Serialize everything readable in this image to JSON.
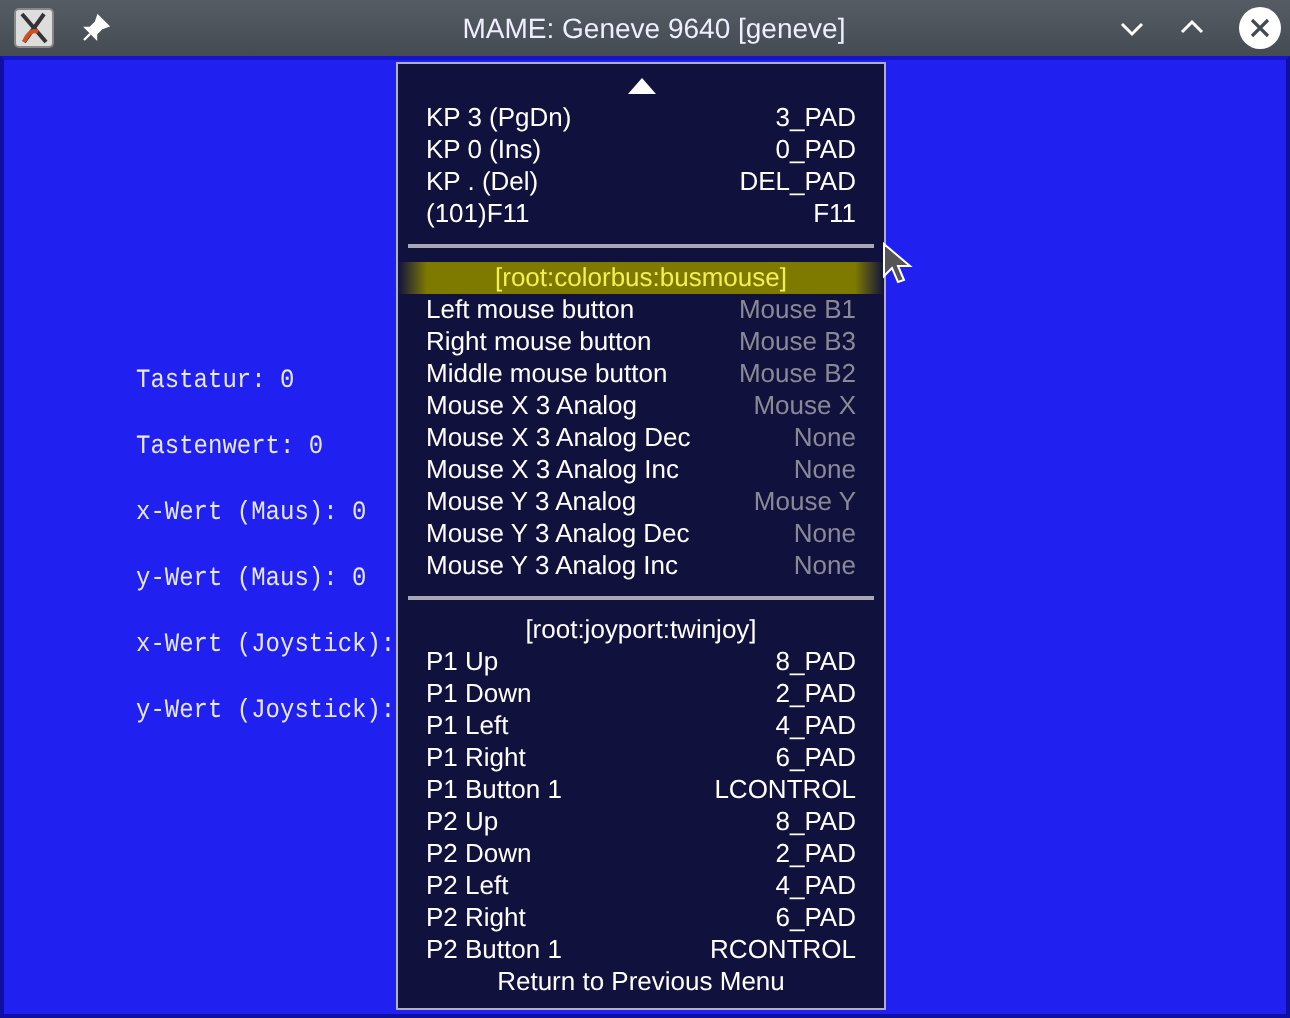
{
  "window": {
    "title": "MAME: Geneve 9640 [geneve]"
  },
  "screen_lines": [
    "Tastatur: 0",
    "Tastenwert: 0",
    "x-Wert (Maus): 0",
    "y-Wert (Maus): 0",
    "x-Wert (Joystick):",
    "y-Wert (Joystick):"
  ],
  "menu": {
    "sections": [
      {
        "items": [
          {
            "label": "KP 3 (PgDn)",
            "value": "3_PAD",
            "dimmed": false
          },
          {
            "label": "KP 0 (Ins)",
            "value": "0_PAD",
            "dimmed": false
          },
          {
            "label": "KP . (Del)",
            "value": "DEL_PAD",
            "dimmed": false
          },
          {
            "label": "(101)F11",
            "value": "F11",
            "dimmed": false
          }
        ]
      },
      {
        "header": "[root:colorbus:busmouse]",
        "selected": true,
        "items": [
          {
            "label": "Left mouse button",
            "value": "Mouse B1",
            "dimmed": true
          },
          {
            "label": "Right mouse button",
            "value": "Mouse B3",
            "dimmed": true
          },
          {
            "label": "Middle mouse button",
            "value": "Mouse B2",
            "dimmed": true
          },
          {
            "label": "Mouse X 3 Analog",
            "value": "Mouse X",
            "dimmed": true
          },
          {
            "label": "Mouse X 3 Analog Dec",
            "value": "None",
            "dimmed": true
          },
          {
            "label": "Mouse X 3 Analog Inc",
            "value": "None",
            "dimmed": true
          },
          {
            "label": "Mouse Y 3 Analog",
            "value": "Mouse Y",
            "dimmed": true
          },
          {
            "label": "Mouse Y 3 Analog Dec",
            "value": "None",
            "dimmed": true
          },
          {
            "label": "Mouse Y 3 Analog Inc",
            "value": "None",
            "dimmed": true
          }
        ]
      },
      {
        "header": "[root:joyport:twinjoy]",
        "selected": false,
        "items": [
          {
            "label": "P1 Up",
            "value": "8_PAD",
            "dimmed": false
          },
          {
            "label": "P1 Down",
            "value": "2_PAD",
            "dimmed": false
          },
          {
            "label": "P1 Left",
            "value": "4_PAD",
            "dimmed": false
          },
          {
            "label": "P1 Right",
            "value": "6_PAD",
            "dimmed": false
          },
          {
            "label": "P1 Button 1",
            "value": "LCONTROL",
            "dimmed": false
          },
          {
            "label": "P2 Up",
            "value": "8_PAD",
            "dimmed": false
          },
          {
            "label": "P2 Down",
            "value": "2_PAD",
            "dimmed": false
          },
          {
            "label": "P2 Left",
            "value": "4_PAD",
            "dimmed": false
          },
          {
            "label": "P2 Right",
            "value": "6_PAD",
            "dimmed": false
          },
          {
            "label": "P2 Button 1",
            "value": "RCONTROL",
            "dimmed": false
          }
        ]
      }
    ],
    "footer": "Return to Previous Menu"
  }
}
